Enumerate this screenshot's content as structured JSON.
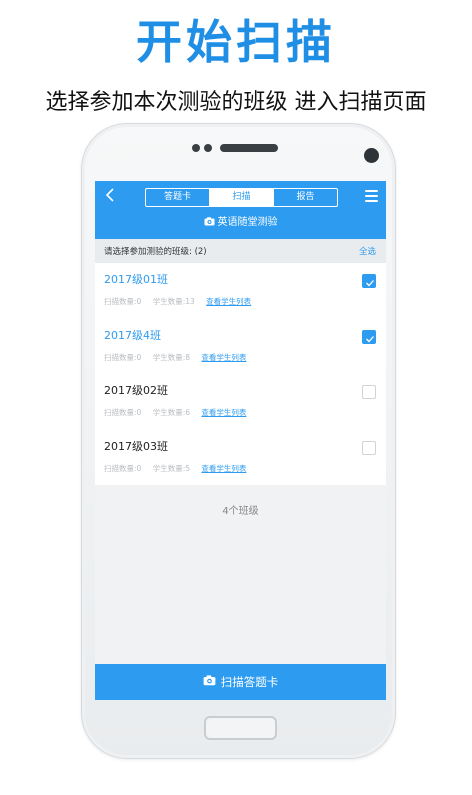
{
  "promo": {
    "headline": "开始扫描",
    "subline": "选择参加本次测验的班级 进入扫描页面"
  },
  "app": {
    "tabs": [
      {
        "label": "答题卡",
        "active": false
      },
      {
        "label": "扫描",
        "active": true
      },
      {
        "label": "报告",
        "active": false
      }
    ],
    "quiz_title": "英语随堂测验",
    "list_header": {
      "prompt": "请选择参加测验的班级: (2)",
      "select_all": "全选"
    },
    "classes": [
      {
        "name": "2017级01班",
        "scanned": "扫描数量:0",
        "students": "学生数量:13",
        "view": "查看学生列表",
        "checked": true
      },
      {
        "name": "2017级4班",
        "scanned": "扫描数量:0",
        "students": "学生数量:8",
        "view": "查看学生列表",
        "checked": true
      },
      {
        "name": "2017级02班",
        "scanned": "扫描数量:0",
        "students": "学生数量:6",
        "view": "查看学生列表",
        "checked": false
      },
      {
        "name": "2017级03班",
        "scanned": "扫描数量:0",
        "students": "学生数量:5",
        "view": "查看学生列表",
        "checked": false
      }
    ],
    "class_count": "4个班级",
    "scan_button": "扫描答题卡"
  },
  "colors": {
    "accent": "#2d9bf0",
    "headline": "#1f8fe6"
  }
}
